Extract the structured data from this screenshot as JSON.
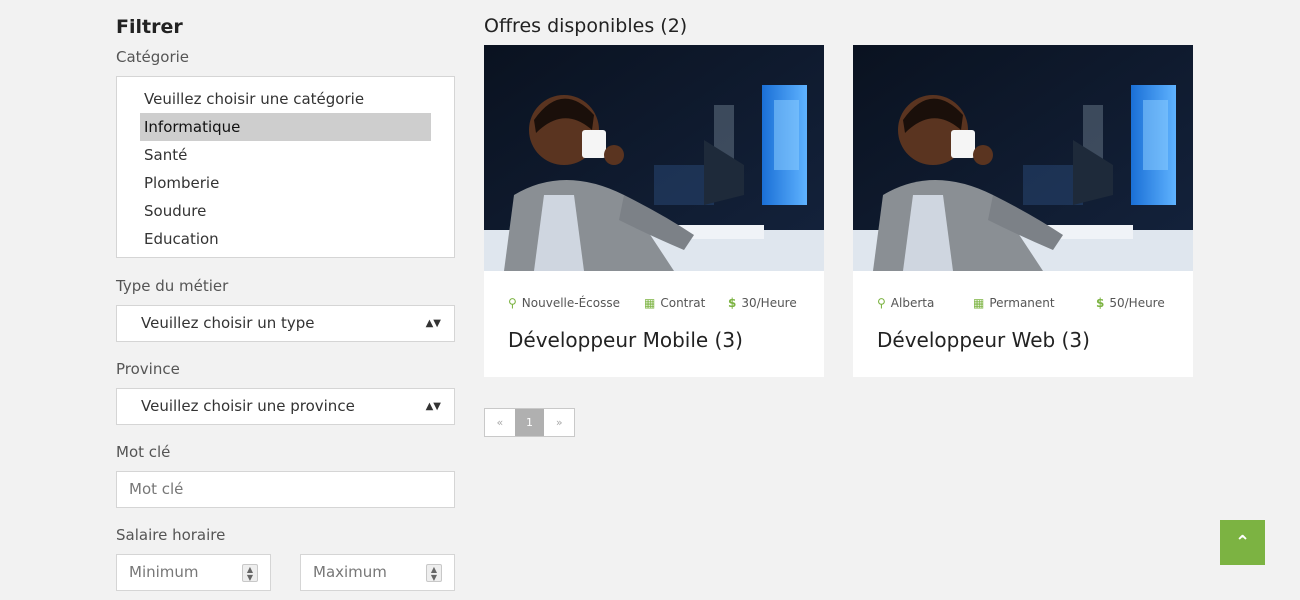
{
  "filters": {
    "title": "Filtrer",
    "category_label": "Catégorie",
    "categories": [
      "Veuillez choisir une catégorie",
      "Informatique",
      "Santé",
      "Plomberie",
      "Soudure",
      "Education"
    ],
    "category_selected": "Informatique",
    "type_label": "Type du métier",
    "type_value": "Veuillez choisir un type",
    "province_label": "Province",
    "province_value": "Veuillez choisir une province",
    "keyword_label": "Mot clé",
    "keyword_placeholder": "Mot clé",
    "salary_label": "Salaire horaire",
    "salary_min_placeholder": "Minimum",
    "salary_max_placeholder": "Maximum"
  },
  "offers": {
    "title": "Offres disponibles (2)",
    "cards": [
      {
        "location": "Nouvelle-Écosse",
        "contract": "Contrat",
        "rate": "30/Heure",
        "title": "Développeur Mobile (3)"
      },
      {
        "location": "Alberta",
        "contract": "Permanent",
        "rate": "50/Heure",
        "title": "Développeur Web (3)"
      }
    ]
  },
  "pagination": {
    "prev": "«",
    "current": "1",
    "next": "»"
  },
  "icons": {
    "location": "map-marker-icon",
    "contract": "calendar-icon",
    "rate": "dollar-icon",
    "back_to_top": "double-chevron-up-icon"
  },
  "colors": {
    "accent": "#7cb342",
    "background": "#f2f2f2",
    "selected_option": "#cecece"
  }
}
